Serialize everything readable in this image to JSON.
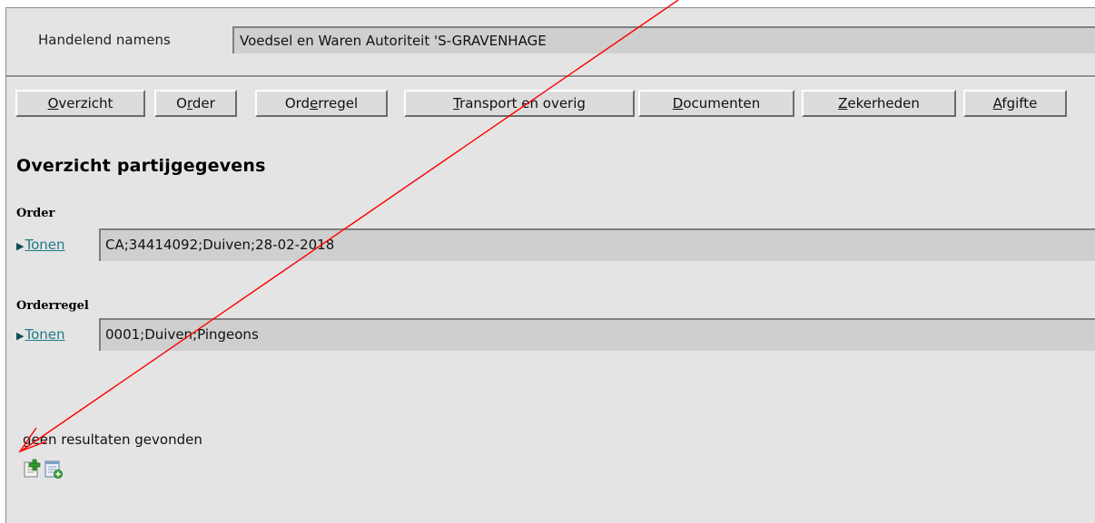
{
  "header": {
    "acting_label": "Handelend namens",
    "acting_value": "Voedsel en Waren Autoriteit 'S-GRAVENHAGE"
  },
  "tabs": [
    {
      "pre": "",
      "key": "O",
      "post": "verzicht"
    },
    {
      "pre": "O",
      "key": "r",
      "post": "der"
    },
    {
      "pre": "Ord",
      "key": "e",
      "post": "rregel"
    },
    {
      "pre": "",
      "key": "T",
      "post": "ransport en overig"
    },
    {
      "pre": "",
      "key": "D",
      "post": "ocumenten"
    },
    {
      "pre": "",
      "key": "Z",
      "post": "ekerheden"
    },
    {
      "pre": "",
      "key": "A",
      "post": "fgifte"
    }
  ],
  "main": {
    "title": "Overzicht partijgegevens",
    "order": {
      "label": "Order",
      "toggle": "Tonen",
      "summary": "CA;34414092;Duiven;28-02-2018"
    },
    "orderregel": {
      "label": "Orderregel",
      "toggle": "Tonen",
      "summary": "0001;Duiven;Pingeons"
    },
    "no_results": "geen resultaten gevonden"
  },
  "icons": {
    "add": "add-item-icon",
    "add_list": "add-list-icon",
    "toggle": "triangle-right-icon"
  },
  "colors": {
    "background": "#e4e4e4",
    "field": "#cfcfcf",
    "link": "#1e7a86",
    "annotation_arrow": "#ff0000"
  }
}
